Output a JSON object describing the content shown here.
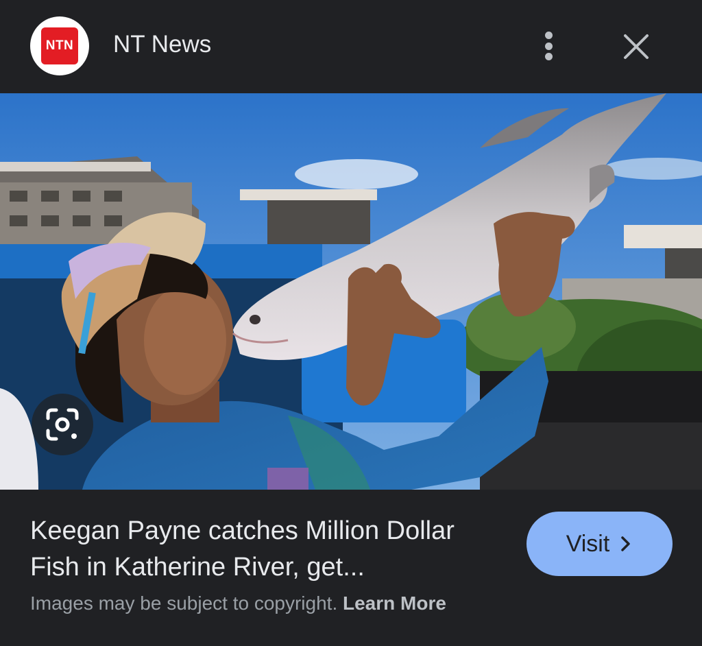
{
  "header": {
    "logo_text": "NTN",
    "source_name": "NT News",
    "more_icon": "more-vert-icon",
    "close_icon": "close-icon"
  },
  "image": {
    "lens_icon": "google-lens-icon"
  },
  "footer": {
    "headline": "Keegan Payne catches Million Dollar Fish in Katherine River, get...",
    "copyright_text": "Images may be subject to copyright.",
    "learn_more_label": "Learn More",
    "visit_label": "Visit",
    "visit_icon": "chevron-right-icon"
  },
  "colors": {
    "background": "#202124",
    "accent": "#8ab4f8",
    "logo_red": "#e31d24"
  }
}
